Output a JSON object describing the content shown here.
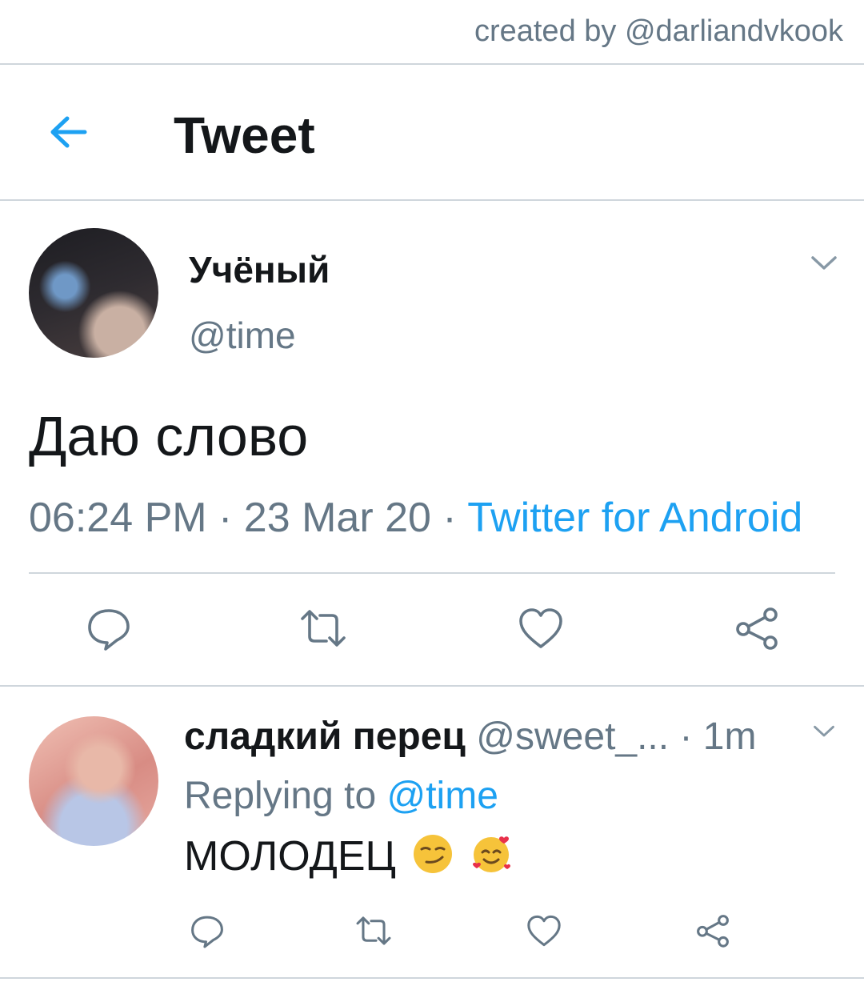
{
  "credit": "created by @darliandvkook",
  "header": {
    "title": "Tweet"
  },
  "tweet": {
    "display_name": "Учёный",
    "handle": "@time",
    "text": "Даю слово",
    "time": "06:24 PM",
    "sep1": " · ",
    "date": "23 Mar 20",
    "sep2": " · ",
    "source": "Twitter for Android"
  },
  "reply": {
    "display_name": "сладкий перец",
    "handle": "@sweet_...",
    "time": "· 1m",
    "replying_label": "Replying to",
    "replying_to": "@time",
    "text": "МОЛОДЕЦ",
    "emojis": [
      "smirk-emoji",
      "smiling-face-with-hearts-emoji"
    ]
  },
  "icons": [
    "back-arrow-icon",
    "chevron-down-icon",
    "reply-icon",
    "retweet-icon",
    "like-icon",
    "share-icon"
  ],
  "colors": {
    "accent": "#1da1f2",
    "secondary_text": "#657786",
    "divider": "#cfd6dc"
  }
}
